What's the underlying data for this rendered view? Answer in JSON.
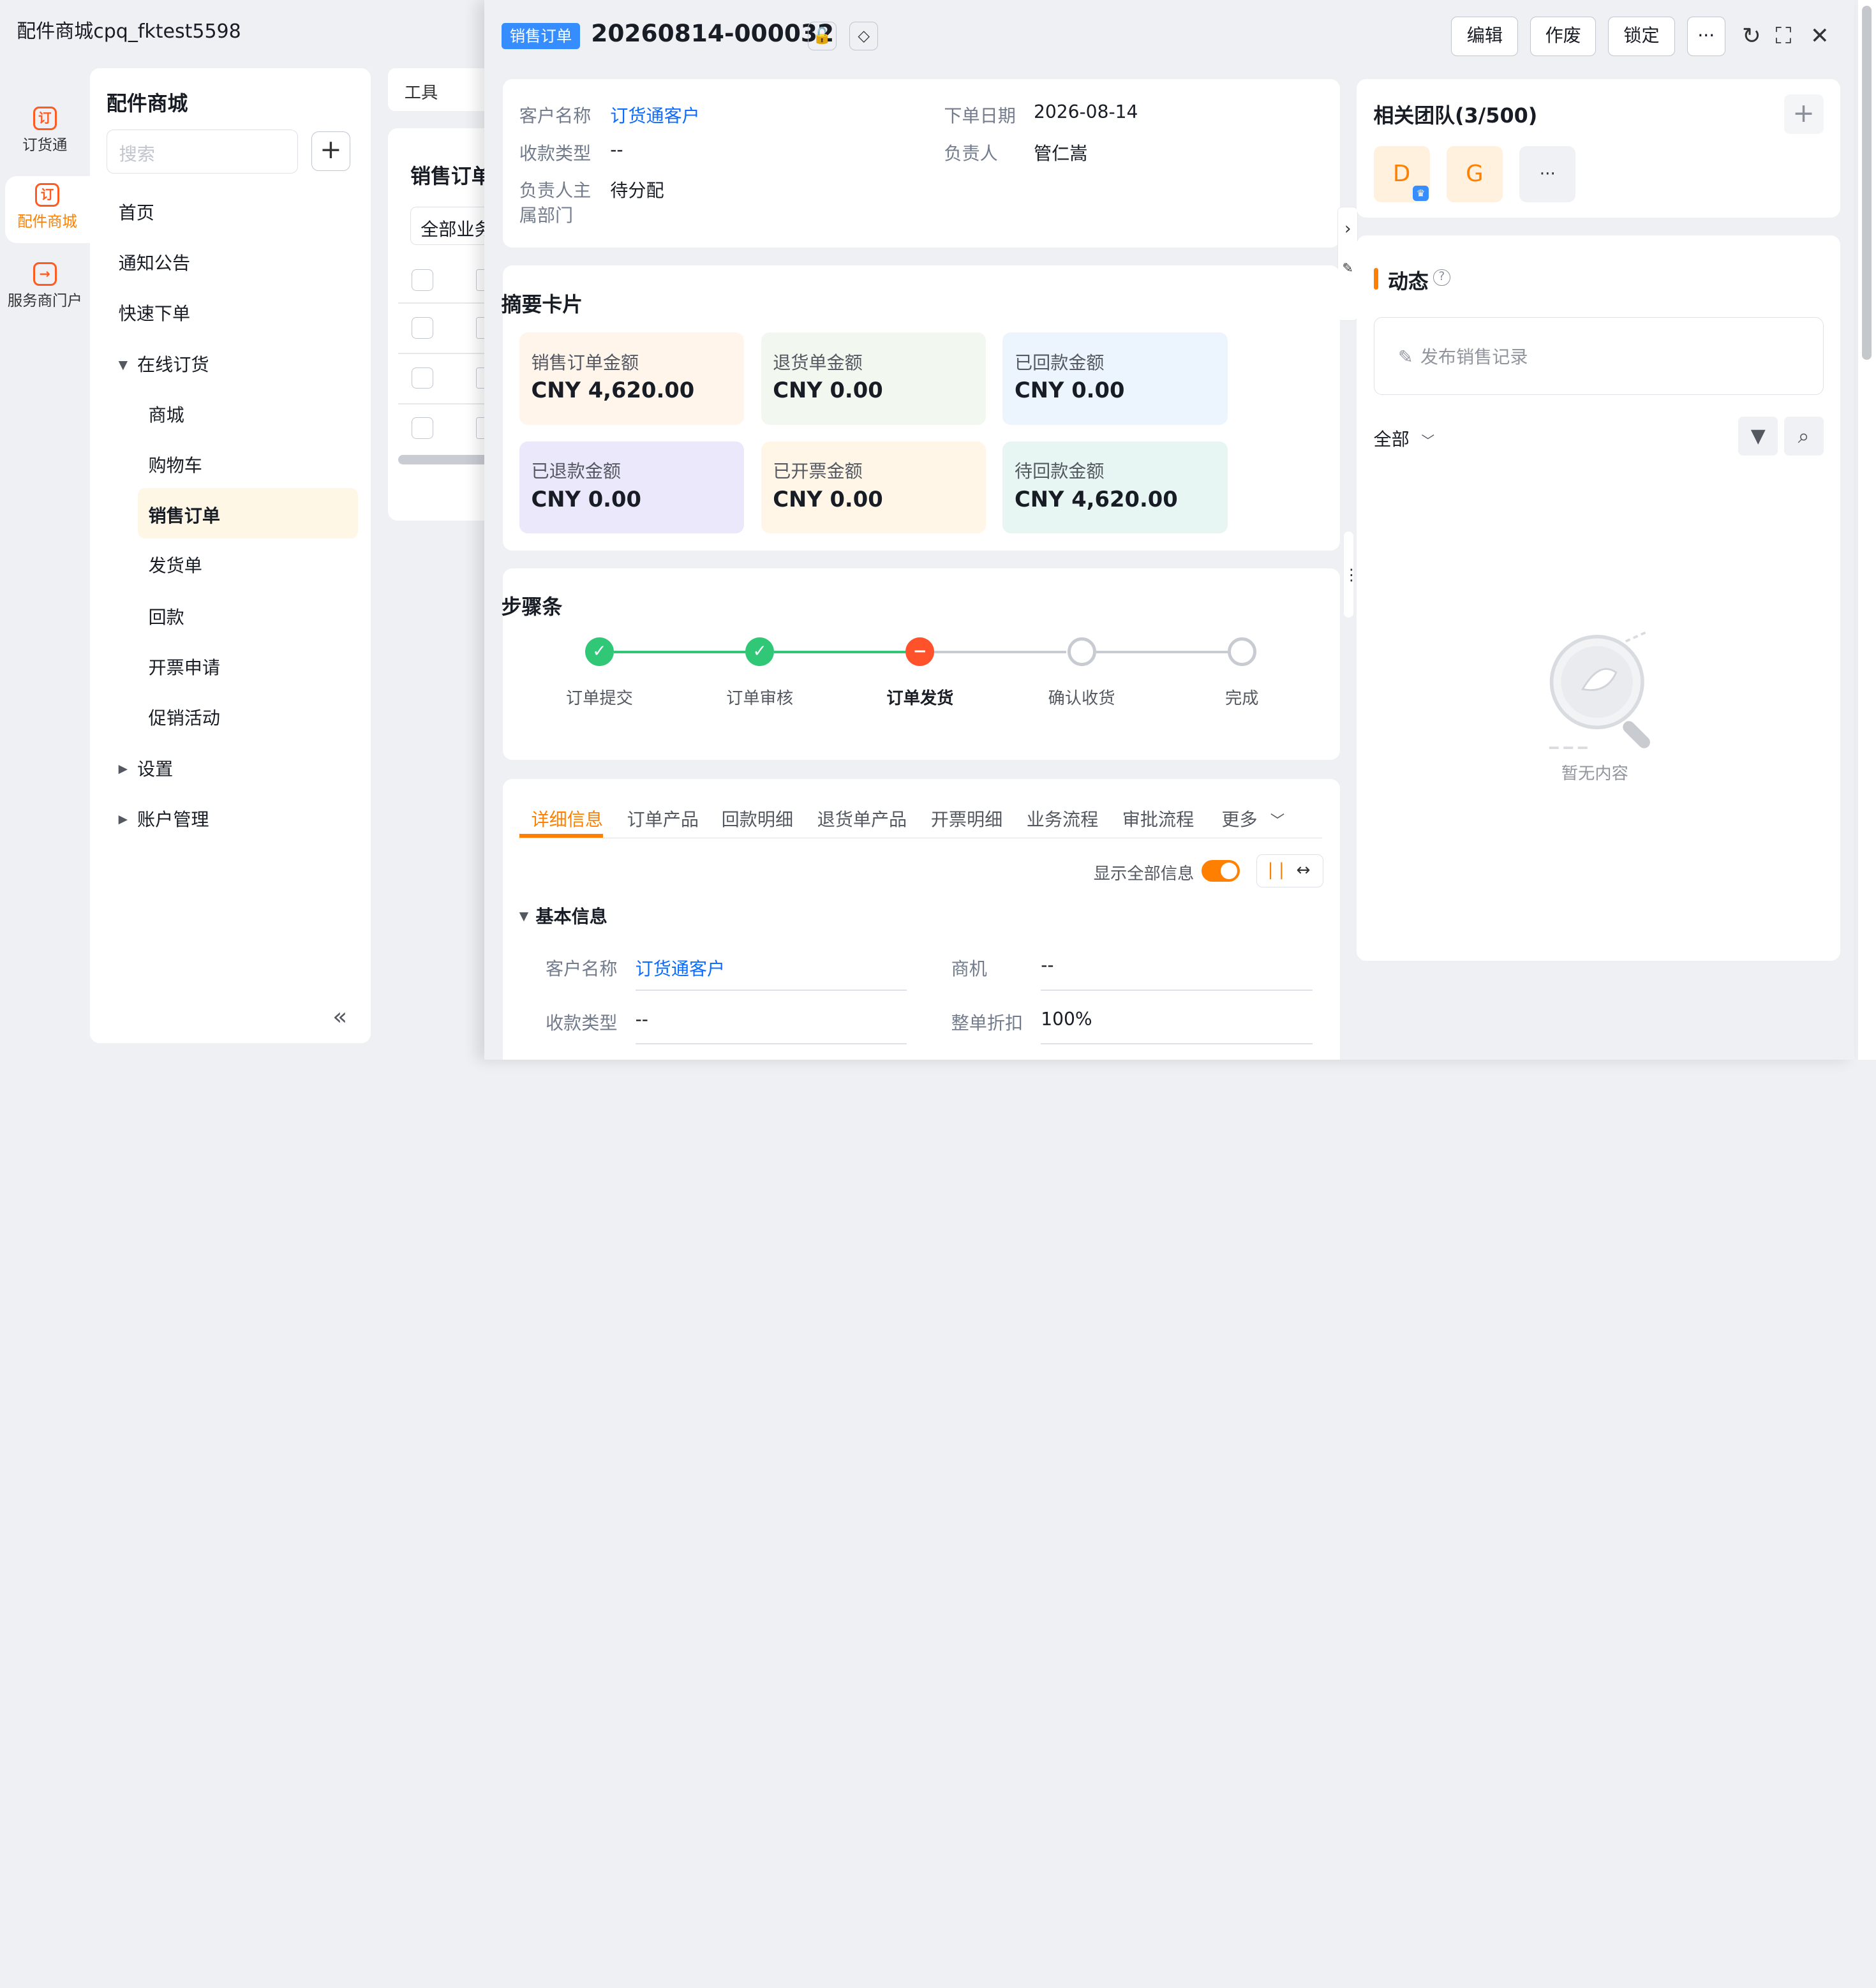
{
  "app": {
    "title": "配件商城cpq_fktest5598"
  },
  "rail": {
    "items": [
      {
        "label": "订货通",
        "icon": "订"
      },
      {
        "label": "配件商城",
        "icon": "订"
      },
      {
        "label": "服务商门户",
        "icon": "→"
      }
    ]
  },
  "nav": {
    "title": "配件商城",
    "search_placeholder": "搜索",
    "add": "+",
    "items": [
      "首页",
      "通知公告",
      "快速下单",
      "在线订货",
      "商城",
      "购物车",
      "销售订单",
      "发货单",
      "回款",
      "开票申请",
      "促销活动",
      "设置",
      "账户管理"
    ],
    "collapse": "«"
  },
  "list": {
    "tab": "工具",
    "title": "销售订单",
    "filter": "全部业务"
  },
  "drawer": {
    "tag": "销售订单",
    "order_no": "20260814-000032",
    "buttons": {
      "edit": "编辑",
      "void": "作废",
      "lock": "锁定",
      "more": "···"
    },
    "info": {
      "customer_label": "客户名称",
      "customer": "订货通客户",
      "order_date_label": "下单日期",
      "order_date": "2026-08-14",
      "pay_type_label": "收款类型",
      "pay_type": "--",
      "owner_label": "负责人",
      "owner": "管仁嵩",
      "dept_label_1": "负责人主",
      "dept_label_2": "属部门",
      "dept": "待分配"
    },
    "summary": {
      "title": "摘要卡片",
      "cards": [
        {
          "label": "销售订单金额",
          "value": "CNY 4,620.00",
          "color": "#fff5eb"
        },
        {
          "label": "退货单金额",
          "value": "CNY 0.00",
          "color": "#f2f8ef"
        },
        {
          "label": "已回款金额",
          "value": "CNY 0.00",
          "color": "#ecf5fd"
        },
        {
          "label": "已退款金额",
          "value": "CNY 0.00",
          "color": "#ece8fb"
        },
        {
          "label": "已开票金额",
          "value": "CNY 0.00",
          "color": "#fff6e8"
        },
        {
          "label": "待回款金额",
          "value": "CNY 4,620.00",
          "color": "#e8f6f3"
        }
      ]
    },
    "steps": {
      "title": "步骤条",
      "items": [
        {
          "label": "订单提交",
          "status": "done"
        },
        {
          "label": "订单审核",
          "status": "done"
        },
        {
          "label": "订单发货",
          "status": "current"
        },
        {
          "label": "确认收货",
          "status": "pending"
        },
        {
          "label": "完成",
          "status": "pending"
        }
      ]
    },
    "tabs": [
      "详细信息",
      "订单产品",
      "回款明细",
      "退货单产品",
      "开票明细",
      "业务流程",
      "审批流程",
      "更多"
    ],
    "show_all_label": "显示全部信息",
    "basic": {
      "title": "基本信息",
      "customer_label": "客户名称",
      "customer": "订货通客户",
      "opportunity_label": "商机",
      "opportunity": "--",
      "pay_type_label": "收款类型",
      "pay_type": "--",
      "discount_label": "整单折扣",
      "discount": "100%"
    }
  },
  "team": {
    "title": "相关团队(3/500)",
    "avatars": [
      "D",
      "G",
      "···"
    ],
    "add": "+"
  },
  "activity": {
    "title": "动态",
    "post_placeholder": "发布销售记录",
    "filter": "全部",
    "empty": "暂无内容"
  },
  "colors": {
    "accent": "#ff8000",
    "link": "#0c6cff",
    "success": "#30c776",
    "error": "#ff522a",
    "tag": "#368dff"
  }
}
